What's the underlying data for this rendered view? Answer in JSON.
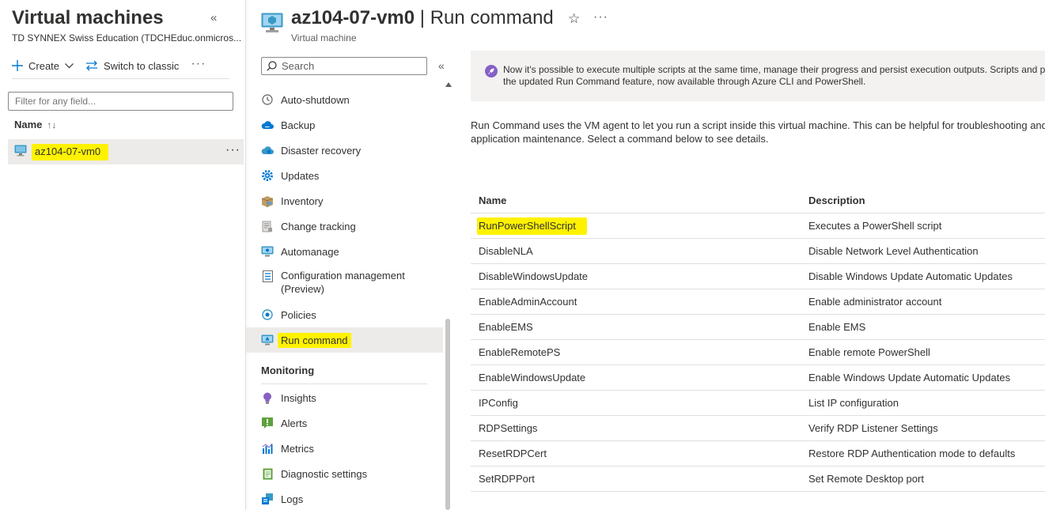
{
  "left_blade": {
    "title": "Virtual machines",
    "subtitle": "TD SYNNEX Swiss Education (TDCHEduc.onmicros...",
    "collapse_glyph": "«",
    "toolbar": {
      "create_label": "Create",
      "switch_label": "Switch to classic",
      "more_glyph": "···"
    },
    "filter_placeholder": "Filter for any field...",
    "column_name": "Name",
    "sort_glyph": "↑↓",
    "vm_item": {
      "name": "az104-07-vm0",
      "more_glyph": "···"
    }
  },
  "header": {
    "vm_name": "az104-07-vm0",
    "separator": " | ",
    "page": "Run command",
    "subtitle": "Virtual machine",
    "star_glyph": "☆",
    "more_glyph": "···"
  },
  "menu": {
    "search_placeholder": "Search",
    "collapse_glyph": "«",
    "items": [
      {
        "label": "Auto-shutdown",
        "icon": "clock-icon"
      },
      {
        "label": "Backup",
        "icon": "backup-cloud-icon"
      },
      {
        "label": "Disaster recovery",
        "icon": "disaster-recovery-icon"
      },
      {
        "label": "Updates",
        "icon": "gear-icon"
      },
      {
        "label": "Inventory",
        "icon": "inventory-box-icon"
      },
      {
        "label": "Change tracking",
        "icon": "change-tracking-icon"
      },
      {
        "label": "Automanage",
        "icon": "automanage-icon"
      },
      {
        "label": "Configuration management (Preview)",
        "icon": "configuration-icon"
      },
      {
        "label": "Policies",
        "icon": "policy-icon"
      },
      {
        "label": "Run command",
        "icon": "run-command-icon",
        "active": true
      }
    ],
    "section_monitoring": "Monitoring",
    "monitoring_items": [
      {
        "label": "Insights",
        "icon": "insights-bulb-icon"
      },
      {
        "label": "Alerts",
        "icon": "alert-icon"
      },
      {
        "label": "Metrics",
        "icon": "metrics-chart-icon"
      },
      {
        "label": "Diagnostic settings",
        "icon": "diagnostic-icon"
      },
      {
        "label": "Logs",
        "icon": "logs-icon"
      }
    ]
  },
  "banner": {
    "line1": "Now it's possible to execute multiple scripts at the same time, manage their progress and persist execution outputs. Scripts and pa",
    "line2": "the updated Run Command feature, now available through Azure CLI and PowerShell.",
    "icon": "rocket-icon",
    "color": "#8661c5"
  },
  "intro": {
    "line1": "Run Command uses the VM agent to let you run a script inside this virtual machine. This can be helpful for troubleshooting and",
    "line2": "application maintenance. Select a command below to see details."
  },
  "table": {
    "headers": {
      "name": "Name",
      "description": "Description"
    },
    "rows": [
      {
        "name": "RunPowerShellScript",
        "description": "Executes a PowerShell script",
        "highlighted": true
      },
      {
        "name": "DisableNLA",
        "description": "Disable Network Level Authentication"
      },
      {
        "name": "DisableWindowsUpdate",
        "description": "Disable Windows Update Automatic Updates"
      },
      {
        "name": "EnableAdminAccount",
        "description": "Enable administrator account"
      },
      {
        "name": "EnableEMS",
        "description": "Enable EMS"
      },
      {
        "name": "EnableRemotePS",
        "description": "Enable remote PowerShell"
      },
      {
        "name": "EnableWindowsUpdate",
        "description": "Enable Windows Update Automatic Updates"
      },
      {
        "name": "IPConfig",
        "description": "List IP configuration"
      },
      {
        "name": "RDPSettings",
        "description": "Verify RDP Listener Settings"
      },
      {
        "name": "ResetRDPCert",
        "description": "Restore RDP Authentication mode to defaults"
      },
      {
        "name": "SetRDPPort",
        "description": "Set Remote Desktop port"
      }
    ]
  },
  "colors": {
    "highlight": "#fff200",
    "accent": "#0078d4",
    "selected_bg": "#edebe9"
  }
}
